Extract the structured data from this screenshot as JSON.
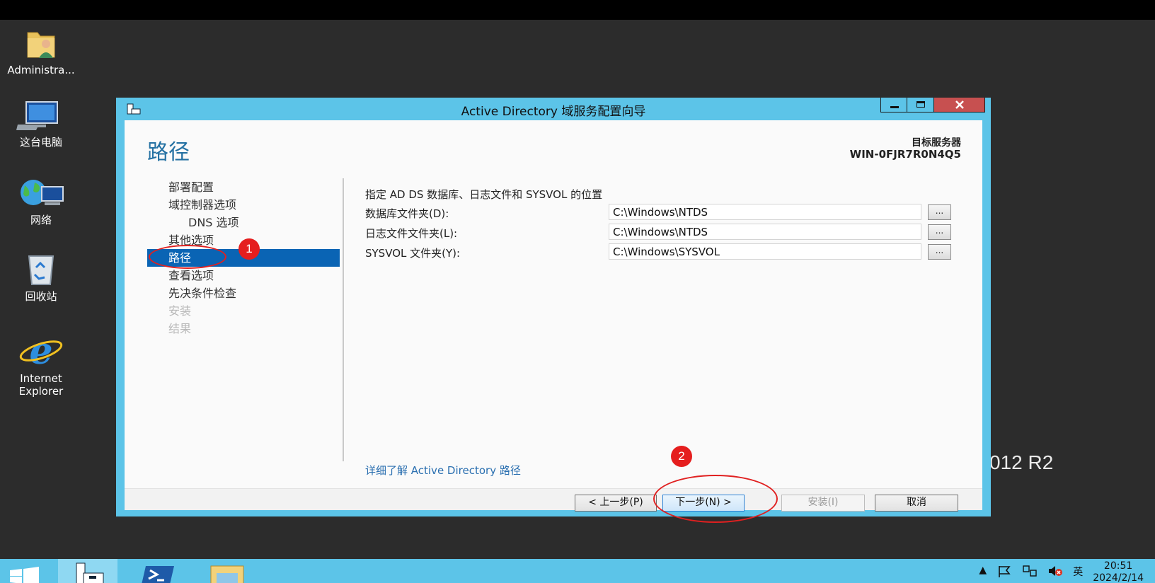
{
  "desktop": {
    "icons": [
      {
        "label": "Administra...",
        "icon": "user-folder-icon"
      },
      {
        "label": "这台电脑",
        "icon": "computer-icon"
      },
      {
        "label": "网络",
        "icon": "network-icon"
      },
      {
        "label": "回收站",
        "icon": "recycle-bin-icon"
      },
      {
        "label": "Internet\nExplorer",
        "icon": "internet-explorer-icon"
      }
    ],
    "watermark": "012 R2"
  },
  "window": {
    "title": "Active Directory 域服务配置向导",
    "page_title": "路径",
    "target_label": "目标服务器",
    "target_server": "WIN-0FJR7R0N4Q5",
    "nav": [
      {
        "label": "部署配置",
        "state": "normal"
      },
      {
        "label": "域控制器选项",
        "state": "normal"
      },
      {
        "label": "DNS 选项",
        "state": "indent"
      },
      {
        "label": "其他选项",
        "state": "normal"
      },
      {
        "label": "路径",
        "state": "active"
      },
      {
        "label": "查看选项",
        "state": "normal"
      },
      {
        "label": "先决条件检查",
        "state": "normal"
      },
      {
        "label": "安装",
        "state": "disabled"
      },
      {
        "label": "结果",
        "state": "disabled"
      }
    ],
    "description": "指定 AD DS 数据库、日志文件和 SYSVOL 的位置",
    "fields": [
      {
        "label": "数据库文件夹(D):",
        "value": "C:\\Windows\\NTDS",
        "browse": "..."
      },
      {
        "label": "日志文件文件夹(L):",
        "value": "C:\\Windows\\NTDS",
        "browse": "..."
      },
      {
        "label": "SYSVOL 文件夹(Y):",
        "value": "C:\\Windows\\SYSVOL",
        "browse": "..."
      }
    ],
    "learn_more": "详细了解 Active Directory 路径",
    "buttons": {
      "prev": "< 上一步(P)",
      "next": "下一步(N) >",
      "install": "安装(I)",
      "cancel": "取消"
    }
  },
  "annotations": {
    "badge1": "1",
    "badge2": "2",
    "color": "#e02020"
  },
  "taskbar": {
    "ime": "英",
    "time": "20:51",
    "date": "2024/2/14"
  },
  "colors": {
    "accent": "#5cc4e8",
    "selection": "#0a64b4",
    "link": "#2a6fb0",
    "close": "#c75050"
  }
}
